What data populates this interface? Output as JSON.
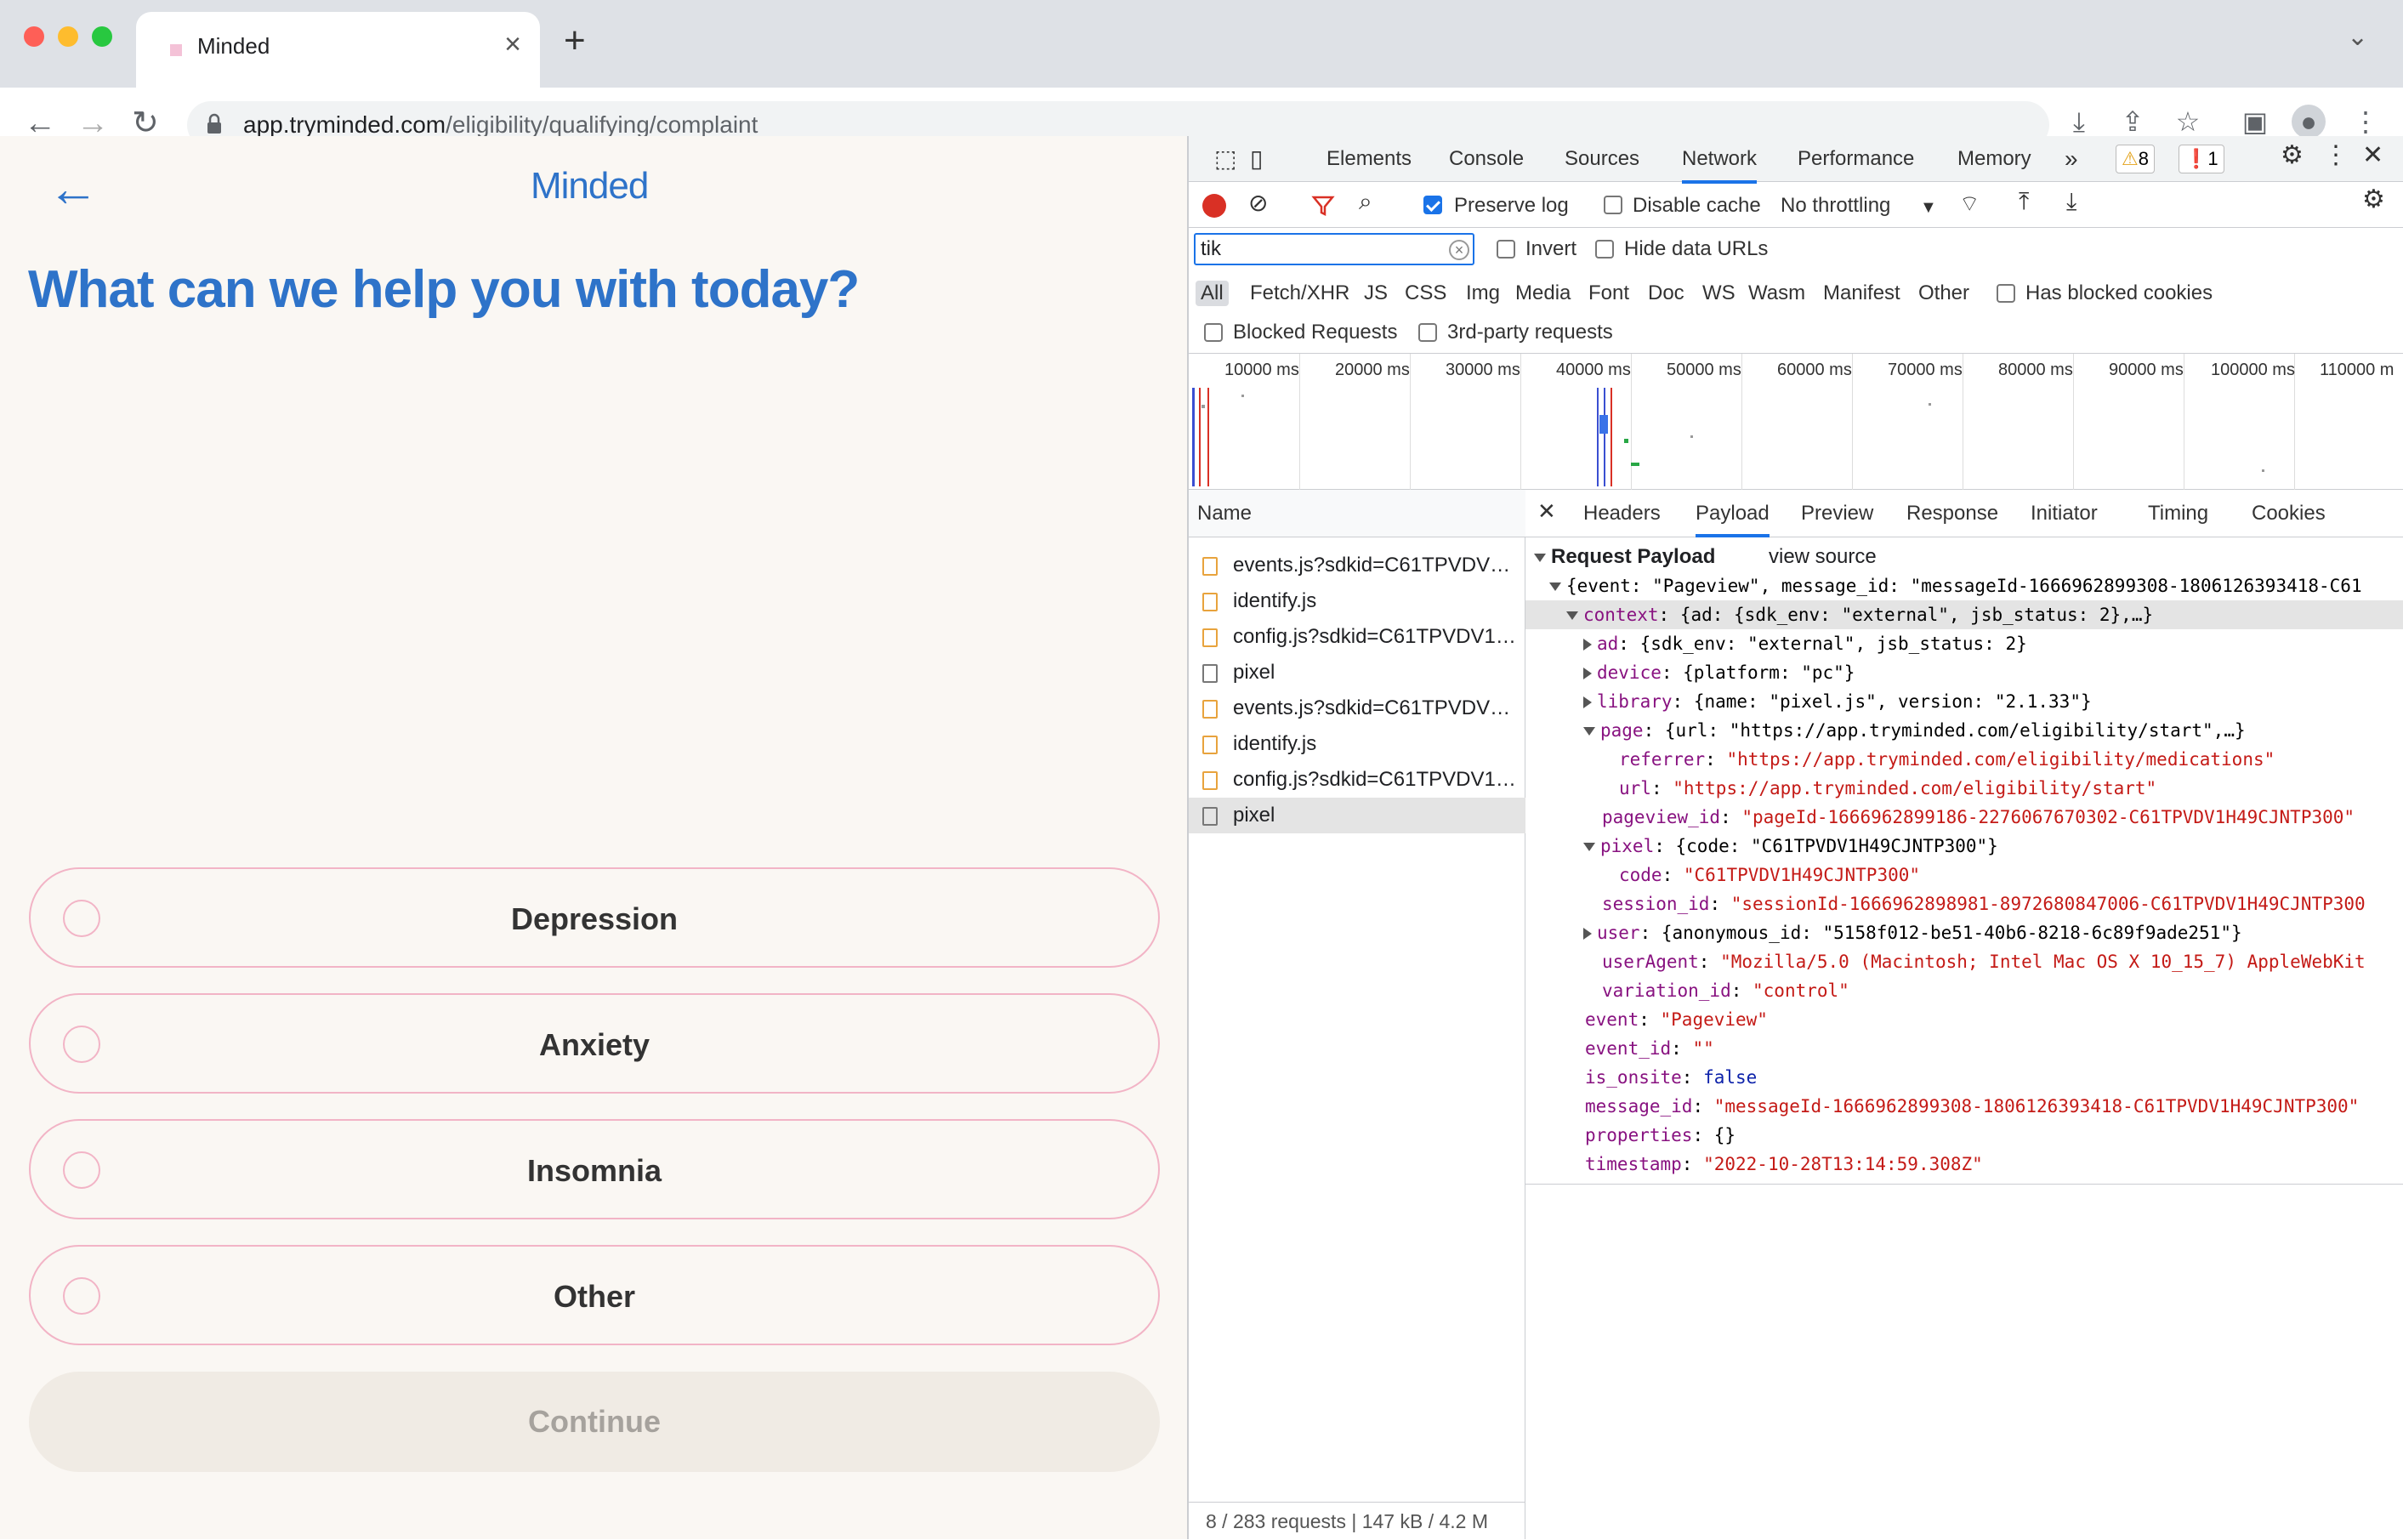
{
  "browser": {
    "tab_title": "Minded",
    "url_host": "app.tryminded.com",
    "url_path": "/eligibility/qualifying/complaint"
  },
  "page": {
    "logo": "Minded",
    "heading": "What can we help you with today?",
    "options": [
      "Depression",
      "Anxiety",
      "Insomnia",
      "Other"
    ],
    "continue_label": "Continue"
  },
  "devtools": {
    "tabs": [
      "Elements",
      "Console",
      "Sources",
      "Network",
      "Performance",
      "Memory"
    ],
    "more": "»",
    "warnings": "8",
    "issues": "1",
    "preserve_log": "Preserve log",
    "disable_cache": "Disable cache",
    "throttling": "No throttling",
    "filter_value": "tik",
    "invert": "Invert",
    "hide_data_urls": "Hide data URLs",
    "types": [
      "All",
      "Fetch/XHR",
      "JS",
      "CSS",
      "Img",
      "Media",
      "Font",
      "Doc",
      "WS",
      "Wasm",
      "Manifest",
      "Other"
    ],
    "has_blocked_cookies": "Has blocked cookies",
    "blocked_requests": "Blocked Requests",
    "third_party": "3rd-party requests",
    "timeline_ticks": [
      "10000 ms",
      "20000 ms",
      "30000 ms",
      "40000 ms",
      "50000 ms",
      "60000 ms",
      "70000 ms",
      "80000 ms",
      "90000 ms",
      "100000 ms",
      "110000 m"
    ],
    "name_header": "Name",
    "requests": [
      {
        "name": "events.js?sdkid=C61TPVDV…",
        "type": "script"
      },
      {
        "name": "identify.js",
        "type": "script"
      },
      {
        "name": "config.js?sdkid=C61TPVDV1…",
        "type": "script"
      },
      {
        "name": "pixel",
        "type": "other"
      },
      {
        "name": "events.js?sdkid=C61TPVDV…",
        "type": "script"
      },
      {
        "name": "identify.js",
        "type": "script"
      },
      {
        "name": "config.js?sdkid=C61TPVDV1…",
        "type": "script"
      },
      {
        "name": "pixel",
        "type": "other"
      }
    ],
    "status": "8 / 283 requests  |  147 kB / 4.2 M",
    "detail_tabs": [
      "Headers",
      "Payload",
      "Preview",
      "Response",
      "Initiator",
      "Timing",
      "Cookies"
    ],
    "request_payload_label": "Request Payload",
    "view_source": "view source",
    "payload_lines": {
      "root": "{event: \"Pageview\", message_id: \"messageId-1666962899308-1806126393418-C61",
      "context_key": "context",
      "context_val": "{ad: {sdk_env: \"external\", jsb_status: 2},…}",
      "ad_key": "ad",
      "ad_val": "{sdk_env: \"external\", jsb_status: 2}",
      "device_key": "device",
      "device_val": "{platform: \"pc\"}",
      "library_key": "library",
      "library_val": "{name: \"pixel.js\", version: \"2.1.33\"}",
      "page_key": "page",
      "page_val": "{url: \"https://app.tryminded.com/eligibility/start\",…}",
      "referrer_key": "referrer",
      "referrer_val": "\"https://app.tryminded.com/eligibility/medications\"",
      "url_key": "url",
      "url_val": "\"https://app.tryminded.com/eligibility/start\"",
      "pageview_id_key": "pageview_id",
      "pageview_id_val": "\"pageId-1666962899186-2276067670302-C61TPVDV1H49CJNTP300\"",
      "pixel_key": "pixel",
      "pixel_val": "{code: \"C61TPVDV1H49CJNTP300\"}",
      "code_key": "code",
      "code_val": "\"C61TPVDV1H49CJNTP300\"",
      "session_id_key": "session_id",
      "session_id_val": "\"sessionId-1666962898981-8972680847006-C61TPVDV1H49CJNTP300",
      "user_key": "user",
      "user_val": "{anonymous_id: \"5158f012-be51-40b6-8218-6c89f9ade251\"}",
      "userAgent_key": "userAgent",
      "userAgent_val": "\"Mozilla/5.0 (Macintosh; Intel Mac OS X 10_15_7) AppleWebKit",
      "variation_id_key": "variation_id",
      "variation_id_val": "\"control\"",
      "event_key": "event",
      "event_val": "\"Pageview\"",
      "event_id_key": "event_id",
      "event_id_val": "\"\"",
      "is_onsite_key": "is_onsite",
      "is_onsite_val": "false",
      "message_id_key": "message_id",
      "message_id_val": "\"messageId-1666962899308-1806126393418-C61TPVDV1H49CJNTP300\"",
      "properties_key": "properties",
      "properties_val": "{}",
      "timestamp_key": "timestamp",
      "timestamp_val": "\"2022-10-28T13:14:59.308Z\""
    }
  },
  "colors": {
    "brand_blue": "#2e73c9",
    "option_border": "#f2b4c6",
    "page_bg": "#faf7f3",
    "devtools_accent": "#1a73e8"
  }
}
